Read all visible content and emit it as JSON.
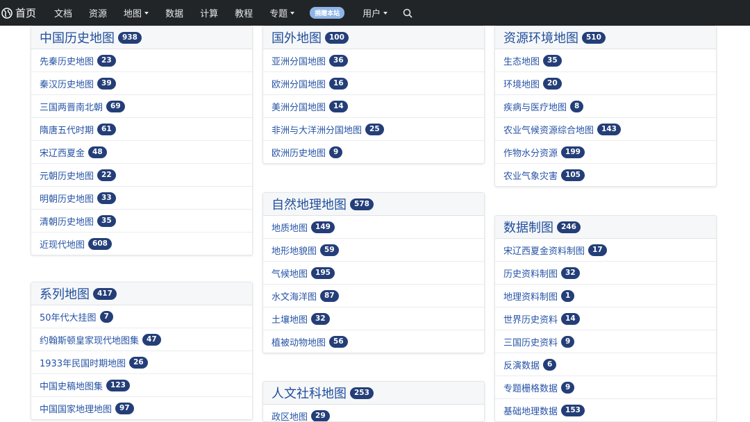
{
  "nav": {
    "brand": "首页",
    "items": [
      {
        "label": "文档",
        "dropdown": false
      },
      {
        "label": "资源",
        "dropdown": false
      },
      {
        "label": "地图",
        "dropdown": true
      },
      {
        "label": "数据",
        "dropdown": false
      },
      {
        "label": "计算",
        "dropdown": false
      },
      {
        "label": "教程",
        "dropdown": false
      },
      {
        "label": "专题",
        "dropdown": true
      }
    ],
    "donate": "捐赠本站",
    "user": "用户"
  },
  "colors": {
    "navbar": "#222528",
    "badge": "#243e78",
    "link": "#2653a6",
    "donate": "#8fb5e8"
  },
  "cards": {
    "history": {
      "title": "中国历史地图",
      "count": "938",
      "items": [
        {
          "label": "先秦历史地图",
          "count": "23"
        },
        {
          "label": "秦汉历史地图",
          "count": "39"
        },
        {
          "label": "三国两晋南北朝",
          "count": "69"
        },
        {
          "label": "隋唐五代时期",
          "count": "61"
        },
        {
          "label": "宋辽西夏金",
          "count": "48"
        },
        {
          "label": "元朝历史地图",
          "count": "22"
        },
        {
          "label": "明朝历史地图",
          "count": "33"
        },
        {
          "label": "清朝历史地图",
          "count": "35"
        },
        {
          "label": "近现代地图",
          "count": "608"
        }
      ]
    },
    "series": {
      "title": "系列地图",
      "count": "417",
      "items": [
        {
          "label": "50年代大挂图",
          "count": "7"
        },
        {
          "label": "约翰斯顿皇家现代地图集",
          "count": "47"
        },
        {
          "label": "1933年民国时期地图",
          "count": "26"
        },
        {
          "label": "中国史稿地图集",
          "count": "123"
        },
        {
          "label": "中国国家地理地图",
          "count": "97"
        }
      ]
    },
    "foreign": {
      "title": "国外地图",
      "count": "100",
      "items": [
        {
          "label": "亚洲分国地图",
          "count": "36"
        },
        {
          "label": "欧洲分国地图",
          "count": "16"
        },
        {
          "label": "美洲分国地图",
          "count": "14"
        },
        {
          "label": "非洲与大洋洲分国地图",
          "count": "25"
        },
        {
          "label": "欧洲历史地图",
          "count": "9"
        }
      ]
    },
    "natural": {
      "title": "自然地理地图",
      "count": "578",
      "items": [
        {
          "label": "地质地图",
          "count": "149"
        },
        {
          "label": "地形地貌图",
          "count": "59"
        },
        {
          "label": "气候地图",
          "count": "195"
        },
        {
          "label": "水文海洋图",
          "count": "87"
        },
        {
          "label": "土壤地图",
          "count": "32"
        },
        {
          "label": "植被动物地图",
          "count": "56"
        }
      ]
    },
    "humanities": {
      "title": "人文社科地图",
      "count": "253",
      "items": [
        {
          "label": "政区地图",
          "count": "29"
        }
      ]
    },
    "resources": {
      "title": "资源环境地图",
      "count": "510",
      "items": [
        {
          "label": "生态地图",
          "count": "35"
        },
        {
          "label": "环境地图",
          "count": "20"
        },
        {
          "label": "疾病与医疗地图",
          "count": "8"
        },
        {
          "label": "农业气候资源综合地图",
          "count": "143"
        },
        {
          "label": "作物水分资源",
          "count": "199"
        },
        {
          "label": "农业气象灾害",
          "count": "105"
        }
      ]
    },
    "data": {
      "title": "数据制图",
      "count": "246",
      "items": [
        {
          "label": "宋辽西夏金资料制图",
          "count": "17"
        },
        {
          "label": "历史资料制图",
          "count": "32"
        },
        {
          "label": "地理资料制图",
          "count": "1"
        },
        {
          "label": "世界历史资料",
          "count": "14"
        },
        {
          "label": "三国历史资料",
          "count": "9"
        },
        {
          "label": "反演数据",
          "count": "6"
        },
        {
          "label": "专题栅格数据",
          "count": "9"
        },
        {
          "label": "基础地理数据",
          "count": "153"
        }
      ]
    }
  }
}
